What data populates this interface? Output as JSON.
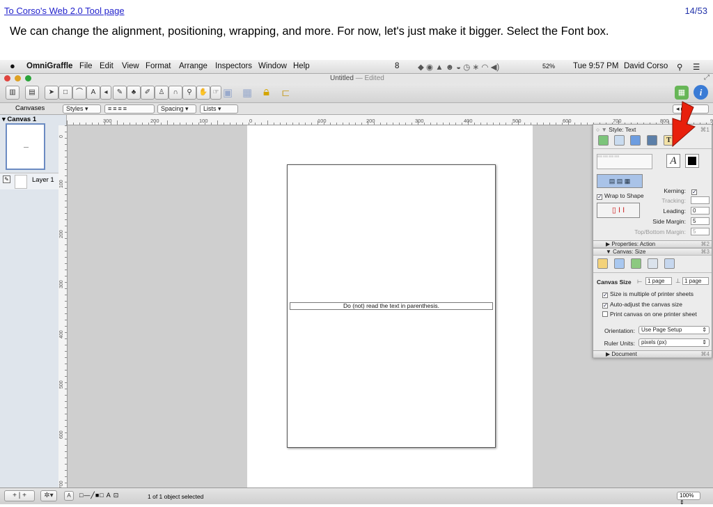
{
  "tutorial": {
    "link": "To Corso's Web 2.0 Tool page",
    "page_counter": "14/53",
    "caption": "We can change the alignment, positioning, wrapping, and more. For now, let's just make it bigger. Select the Font box."
  },
  "menubar": {
    "app": "OmniGraffle",
    "items": [
      "File",
      "Edit",
      "View",
      "Format",
      "Arrange",
      "Inspectors",
      "Window",
      "Help"
    ],
    "status_num": "8",
    "battery": "52%",
    "clock": "Tue 9:57 PM",
    "user": "David Corso"
  },
  "window": {
    "title": "Untitled",
    "edited": "— Edited"
  },
  "subbar": {
    "styles": "Styles",
    "spacing": "Spacing",
    "lists": "Lists"
  },
  "sidebar": {
    "header": "Canvases",
    "canvas_name": "Canvas 1",
    "layer_name": "Layer 1"
  },
  "rulers": {
    "h_ticks": [
      "300",
      "200",
      "100",
      "0",
      "100",
      "200",
      "300",
      "400",
      "500",
      "600",
      "700",
      "800",
      "900"
    ],
    "v_ticks": [
      "0",
      "100",
      "200",
      "300",
      "400",
      "500",
      "600",
      "700"
    ]
  },
  "canvas": {
    "text_object": "Do (not) read the text in parenthesis."
  },
  "inspector": {
    "style_text_title": "Style: Text",
    "style_text_shortcut": "⌘1",
    "wrap_to_shape": "Wrap to Shape",
    "kerning_label": "Kerning:",
    "tracking_label": "Tracking:",
    "leading_label": "Leading:",
    "leading_value": "0",
    "side_margin_label": "Side Margin:",
    "side_margin_value": "5",
    "topbottom_label": "Top/Bottom Margin:",
    "topbottom_value": "5",
    "properties_title": "Properties: Action",
    "properties_shortcut": "⌘2",
    "canvas_title": "Canvas: Size",
    "canvas_shortcut": "⌘3",
    "canvas_size_label": "Canvas Size",
    "width_value": "1 page",
    "height_value": "1 page",
    "opt_multiple": "Size is multiple of printer sheets",
    "opt_auto": "Auto-adjust the canvas size",
    "opt_print": "Print canvas on one printer sheet",
    "orientation_label": "Orientation:",
    "orientation_value": "Use Page Setup",
    "ruler_units_label": "Ruler Units:",
    "ruler_units_value": "pixels (px)",
    "document_title": "Document",
    "document_shortcut": "⌘4"
  },
  "status": {
    "selection": "1 of 1 object selected",
    "zoom": "100%",
    "font_letter": "A"
  },
  "colors": {
    "arrow": "#e8200c",
    "link": "#2222cc",
    "accent_green": "#4caf50",
    "accent_blue": "#3a7bd5"
  }
}
